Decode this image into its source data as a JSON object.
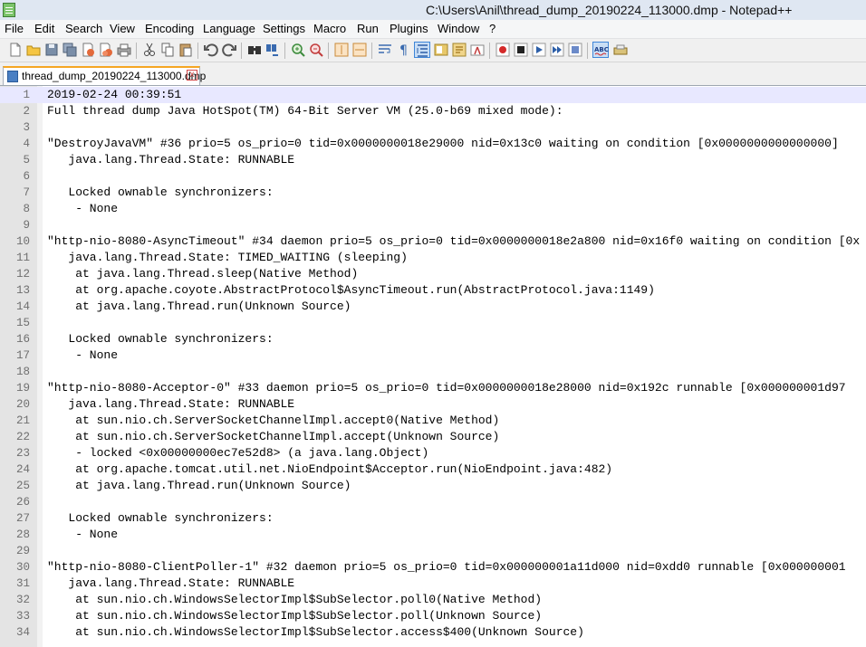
{
  "window": {
    "title": "C:\\Users\\Anil\\thread_dump_20190224_113000.dmp - Notepad++"
  },
  "menu": [
    "File",
    "Edit",
    "Search",
    "View",
    "Encoding",
    "Language",
    "Settings",
    "Macro",
    "Run",
    "Plugins",
    "Window",
    "?"
  ],
  "toolbar": {
    "icons": [
      "new-file-icon",
      "open-file-icon",
      "save-icon",
      "save-all-icon",
      "close-icon",
      "close-all-icon",
      "print-icon",
      "cut-icon",
      "copy-icon",
      "paste-icon",
      "undo-icon",
      "redo-icon",
      "find-icon",
      "replace-icon",
      "zoom-in-icon",
      "zoom-out-icon",
      "sync-vertical-icon",
      "sync-horizontal-icon",
      "word-wrap-icon",
      "show-all-chars-icon",
      "indent-guide-icon",
      "document-map-icon",
      "function-list-icon",
      "folder-workspace-icon",
      "record-macro-icon",
      "stop-macro-icon",
      "play-macro-icon",
      "run-macro-multiple-icon",
      "save-macro-icon",
      "spellcheck-icon",
      "plugin-icon"
    ]
  },
  "tab": {
    "label": "thread_dump_20190224_113000.dmp",
    "close_glyph": "x"
  },
  "editor": {
    "current_line": 1,
    "lines": [
      {
        "n": "1",
        "text": "2019-02-24 00:39:51"
      },
      {
        "n": "2",
        "text": "Full thread dump Java HotSpot(TM) 64-Bit Server VM (25.0-b69 mixed mode):"
      },
      {
        "n": "3",
        "text": ""
      },
      {
        "n": "4",
        "text": "\"DestroyJavaVM\" #36 prio=5 os_prio=0 tid=0x0000000018e29000 nid=0x13c0 waiting on condition [0x0000000000000000]"
      },
      {
        "n": "5",
        "text": "   java.lang.Thread.State: RUNNABLE"
      },
      {
        "n": "6",
        "text": ""
      },
      {
        "n": "7",
        "text": "   Locked ownable synchronizers:"
      },
      {
        "n": "8",
        "text": "    - None"
      },
      {
        "n": "9",
        "text": ""
      },
      {
        "n": "10",
        "text": "\"http-nio-8080-AsyncTimeout\" #34 daemon prio=5 os_prio=0 tid=0x0000000018e2a800 nid=0x16f0 waiting on condition [0x"
      },
      {
        "n": "11",
        "text": "   java.lang.Thread.State: TIMED_WAITING (sleeping)"
      },
      {
        "n": "12",
        "text": "    at java.lang.Thread.sleep(Native Method)"
      },
      {
        "n": "13",
        "text": "    at org.apache.coyote.AbstractProtocol$AsyncTimeout.run(AbstractProtocol.java:1149)"
      },
      {
        "n": "14",
        "text": "    at java.lang.Thread.run(Unknown Source)"
      },
      {
        "n": "15",
        "text": ""
      },
      {
        "n": "16",
        "text": "   Locked ownable synchronizers:"
      },
      {
        "n": "17",
        "text": "    - None"
      },
      {
        "n": "18",
        "text": ""
      },
      {
        "n": "19",
        "text": "\"http-nio-8080-Acceptor-0\" #33 daemon prio=5 os_prio=0 tid=0x0000000018e28000 nid=0x192c runnable [0x000000001d97"
      },
      {
        "n": "20",
        "text": "   java.lang.Thread.State: RUNNABLE"
      },
      {
        "n": "21",
        "text": "    at sun.nio.ch.ServerSocketChannelImpl.accept0(Native Method)"
      },
      {
        "n": "22",
        "text": "    at sun.nio.ch.ServerSocketChannelImpl.accept(Unknown Source)"
      },
      {
        "n": "23",
        "text": "    - locked <0x00000000ec7e52d8> (a java.lang.Object)"
      },
      {
        "n": "24",
        "text": "    at org.apache.tomcat.util.net.NioEndpoint$Acceptor.run(NioEndpoint.java:482)"
      },
      {
        "n": "25",
        "text": "    at java.lang.Thread.run(Unknown Source)"
      },
      {
        "n": "26",
        "text": ""
      },
      {
        "n": "27",
        "text": "   Locked ownable synchronizers:"
      },
      {
        "n": "28",
        "text": "    - None"
      },
      {
        "n": "29",
        "text": ""
      },
      {
        "n": "30",
        "text": "\"http-nio-8080-ClientPoller-1\" #32 daemon prio=5 os_prio=0 tid=0x000000001a11d000 nid=0xdd0 runnable [0x000000001"
      },
      {
        "n": "31",
        "text": "   java.lang.Thread.State: RUNNABLE"
      },
      {
        "n": "32",
        "text": "    at sun.nio.ch.WindowsSelectorImpl$SubSelector.poll0(Native Method)"
      },
      {
        "n": "33",
        "text": "    at sun.nio.ch.WindowsSelectorImpl$SubSelector.poll(Unknown Source)"
      },
      {
        "n": "34",
        "text": "    at sun.nio.ch.WindowsSelectorImpl$SubSelector.access$400(Unknown Source)"
      }
    ]
  }
}
